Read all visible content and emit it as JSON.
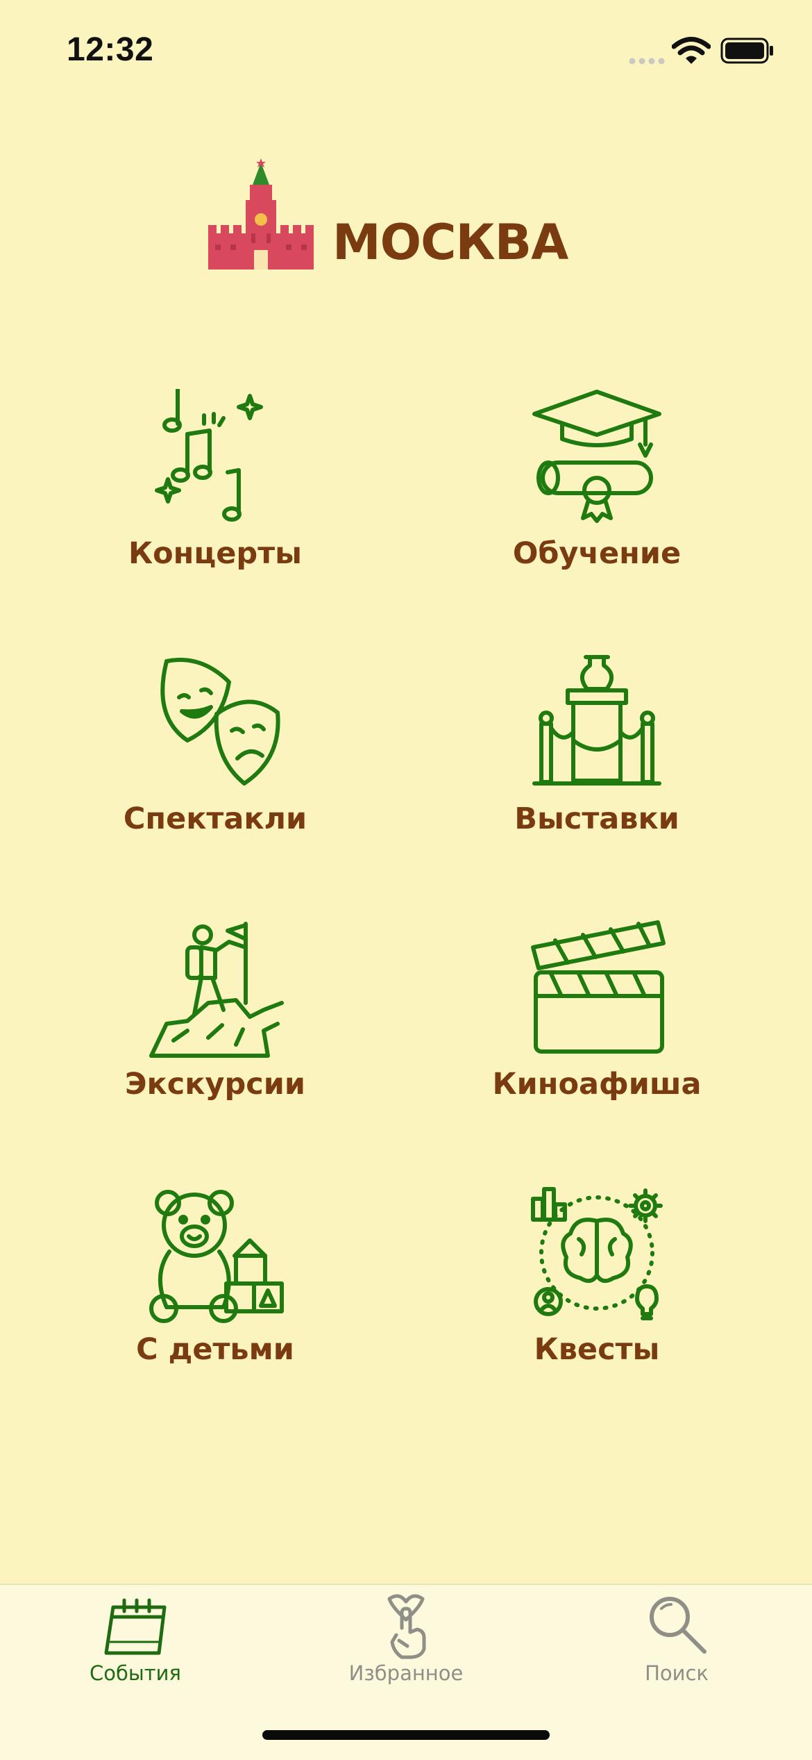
{
  "status_bar": {
    "time": "12:32"
  },
  "header": {
    "city": "МОСКВА",
    "logo_icon": "kremlin-tower-icon"
  },
  "categories": [
    {
      "label": "Концерты",
      "icon": "music-notes-icon"
    },
    {
      "label": "Обучение",
      "icon": "graduation-cap-icon"
    },
    {
      "label": "Спектакли",
      "icon": "theater-masks-icon"
    },
    {
      "label": "Выставки",
      "icon": "museum-exhibit-icon"
    },
    {
      "label": "Экскурсии",
      "icon": "hiker-flag-icon"
    },
    {
      "label": "Киноафиша",
      "icon": "clapperboard-icon"
    },
    {
      "label": "С детьми",
      "icon": "teddy-bear-icon"
    },
    {
      "label": "Квесты",
      "icon": "brain-puzzle-icon"
    }
  ],
  "tab_bar": {
    "tabs": [
      {
        "label": "События",
        "icon": "calendar-icon",
        "active": true
      },
      {
        "label": "Избранное",
        "icon": "heart-hand-icon",
        "active": false
      },
      {
        "label": "Поиск",
        "icon": "search-icon",
        "active": false
      }
    ],
    "active_color": "#1f6b12",
    "inactive_color": "#8f8f88"
  },
  "colors": {
    "background": "#fbf4bf",
    "icon_green": "#1f7a0f",
    "label_brown": "#7a3b10",
    "logo_red": "#d9495e"
  }
}
